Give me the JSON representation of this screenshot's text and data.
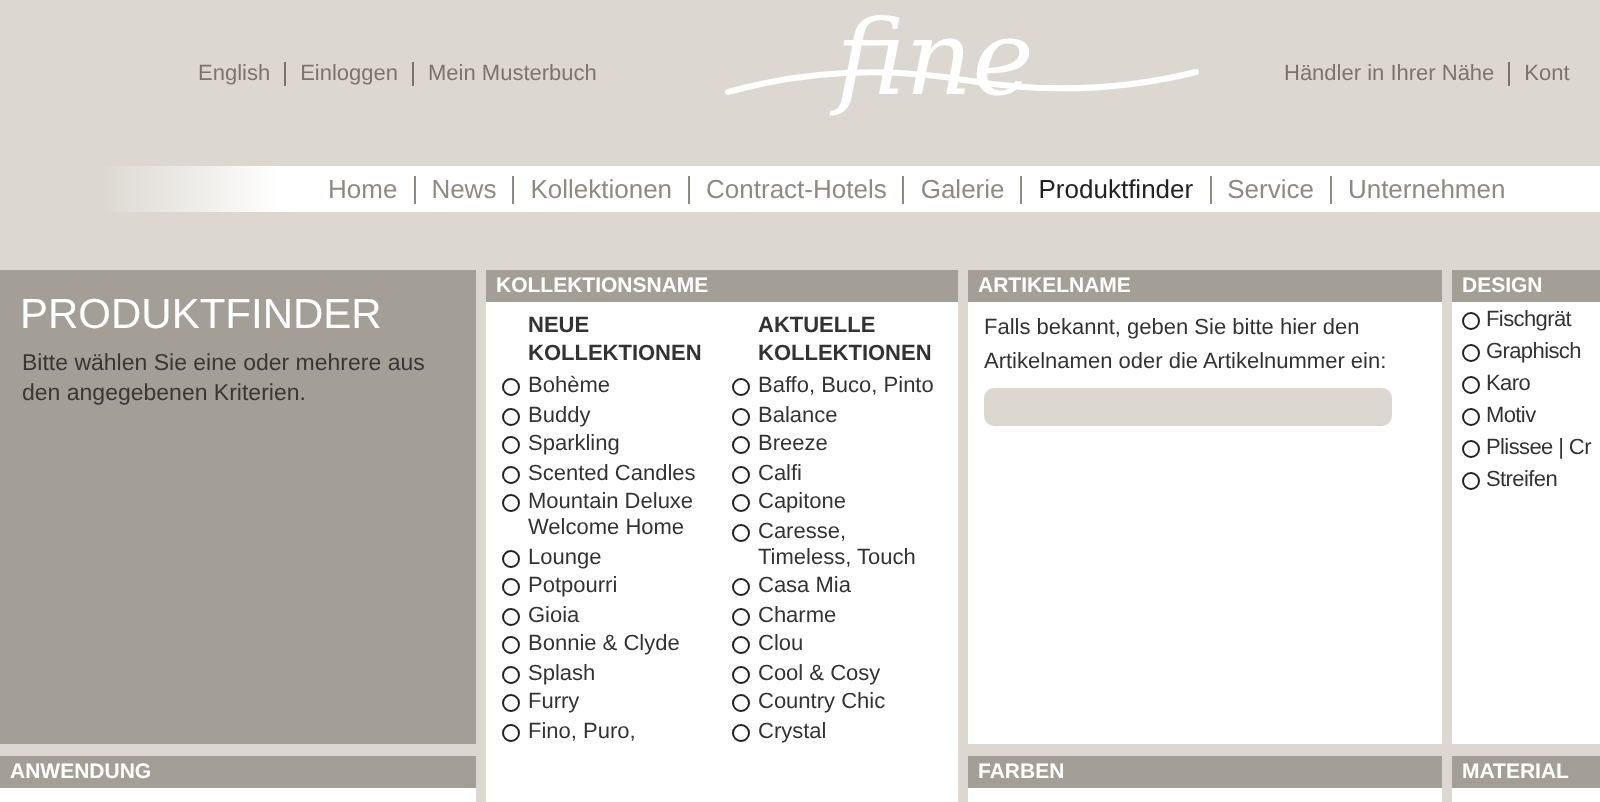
{
  "top_links": [
    "English",
    "Einloggen",
    "Mein Musterbuch"
  ],
  "logo": {
    "text": "fine"
  },
  "right_links": [
    "Händler in Ihrer Nähe",
    "Kont"
  ],
  "nav": [
    {
      "label": "Home",
      "selected": false
    },
    {
      "label": "News",
      "selected": false
    },
    {
      "label": "Kollektionen",
      "selected": false
    },
    {
      "label": "Contract-Hotels",
      "selected": false
    },
    {
      "label": "Galerie",
      "selected": false
    },
    {
      "label": "Produktfinder",
      "selected": true
    },
    {
      "label": "Service",
      "selected": false
    },
    {
      "label": "Unternehmen",
      "selected": false
    }
  ],
  "intro": {
    "title": "PRODUKTFINDER",
    "text": "Bitte wählen Sie eine oder mehrere aus den angegebenen Kriterien."
  },
  "anwendung": {
    "header": "ANWENDUNG"
  },
  "kollektionsname": {
    "header": "KOLLEKTIONSNAME",
    "columns": [
      {
        "heading": "NEUE KOLLEKTIONEN",
        "options": [
          {
            "label": "Bohème",
            "selected": false
          },
          {
            "label": "Buddy",
            "selected": false
          },
          {
            "label": "Sparkling",
            "selected": false
          },
          {
            "label": "Scented Candles",
            "selected": false
          },
          {
            "label": "Mountain Deluxe Welcome Home",
            "selected": false
          },
          {
            "label": "Lounge",
            "selected": false
          },
          {
            "label": "Potpourri",
            "selected": false
          },
          {
            "label": "Gioia",
            "selected": false
          },
          {
            "label": "Bonnie & Clyde",
            "selected": false
          },
          {
            "label": "Splash",
            "selected": false
          },
          {
            "label": "Furry",
            "selected": false
          },
          {
            "label": "Fino, Puro,",
            "selected": false
          }
        ]
      },
      {
        "heading": "AKTUELLE KOLLEKTIONEN",
        "options": [
          {
            "label": "Baffo, Buco, Pinto",
            "selected": false
          },
          {
            "label": "Balance",
            "selected": false
          },
          {
            "label": "Breeze",
            "selected": false
          },
          {
            "label": "Calfi",
            "selected": false
          },
          {
            "label": "Capitone",
            "selected": false
          },
          {
            "label": "Caresse, Timeless, Touch",
            "selected": false
          },
          {
            "label": "Casa Mia",
            "selected": false
          },
          {
            "label": "Charme",
            "selected": false
          },
          {
            "label": "Clou",
            "selected": false
          },
          {
            "label": "Cool & Cosy",
            "selected": false
          },
          {
            "label": "Country Chic",
            "selected": false
          },
          {
            "label": "Crystal",
            "selected": false
          }
        ]
      }
    ]
  },
  "artikelname": {
    "header": "ARTIKELNAME",
    "text": "Falls bekannt, geben Sie bitte hier den Artikelnamen oder die Artikelnummer ein:"
  },
  "farben": {
    "header": "FARBEN"
  },
  "design": {
    "header": "DESIGN",
    "options": [
      {
        "label": "Fischgrät",
        "selected": false
      },
      {
        "label": "Graphisch",
        "selected": false
      },
      {
        "label": "Karo",
        "selected": false
      },
      {
        "label": "Motiv",
        "selected": false
      },
      {
        "label": "Plissee | Cr",
        "selected": false
      },
      {
        "label": "Streifen",
        "selected": false
      }
    ]
  },
  "material": {
    "header": "MATERIAL"
  }
}
